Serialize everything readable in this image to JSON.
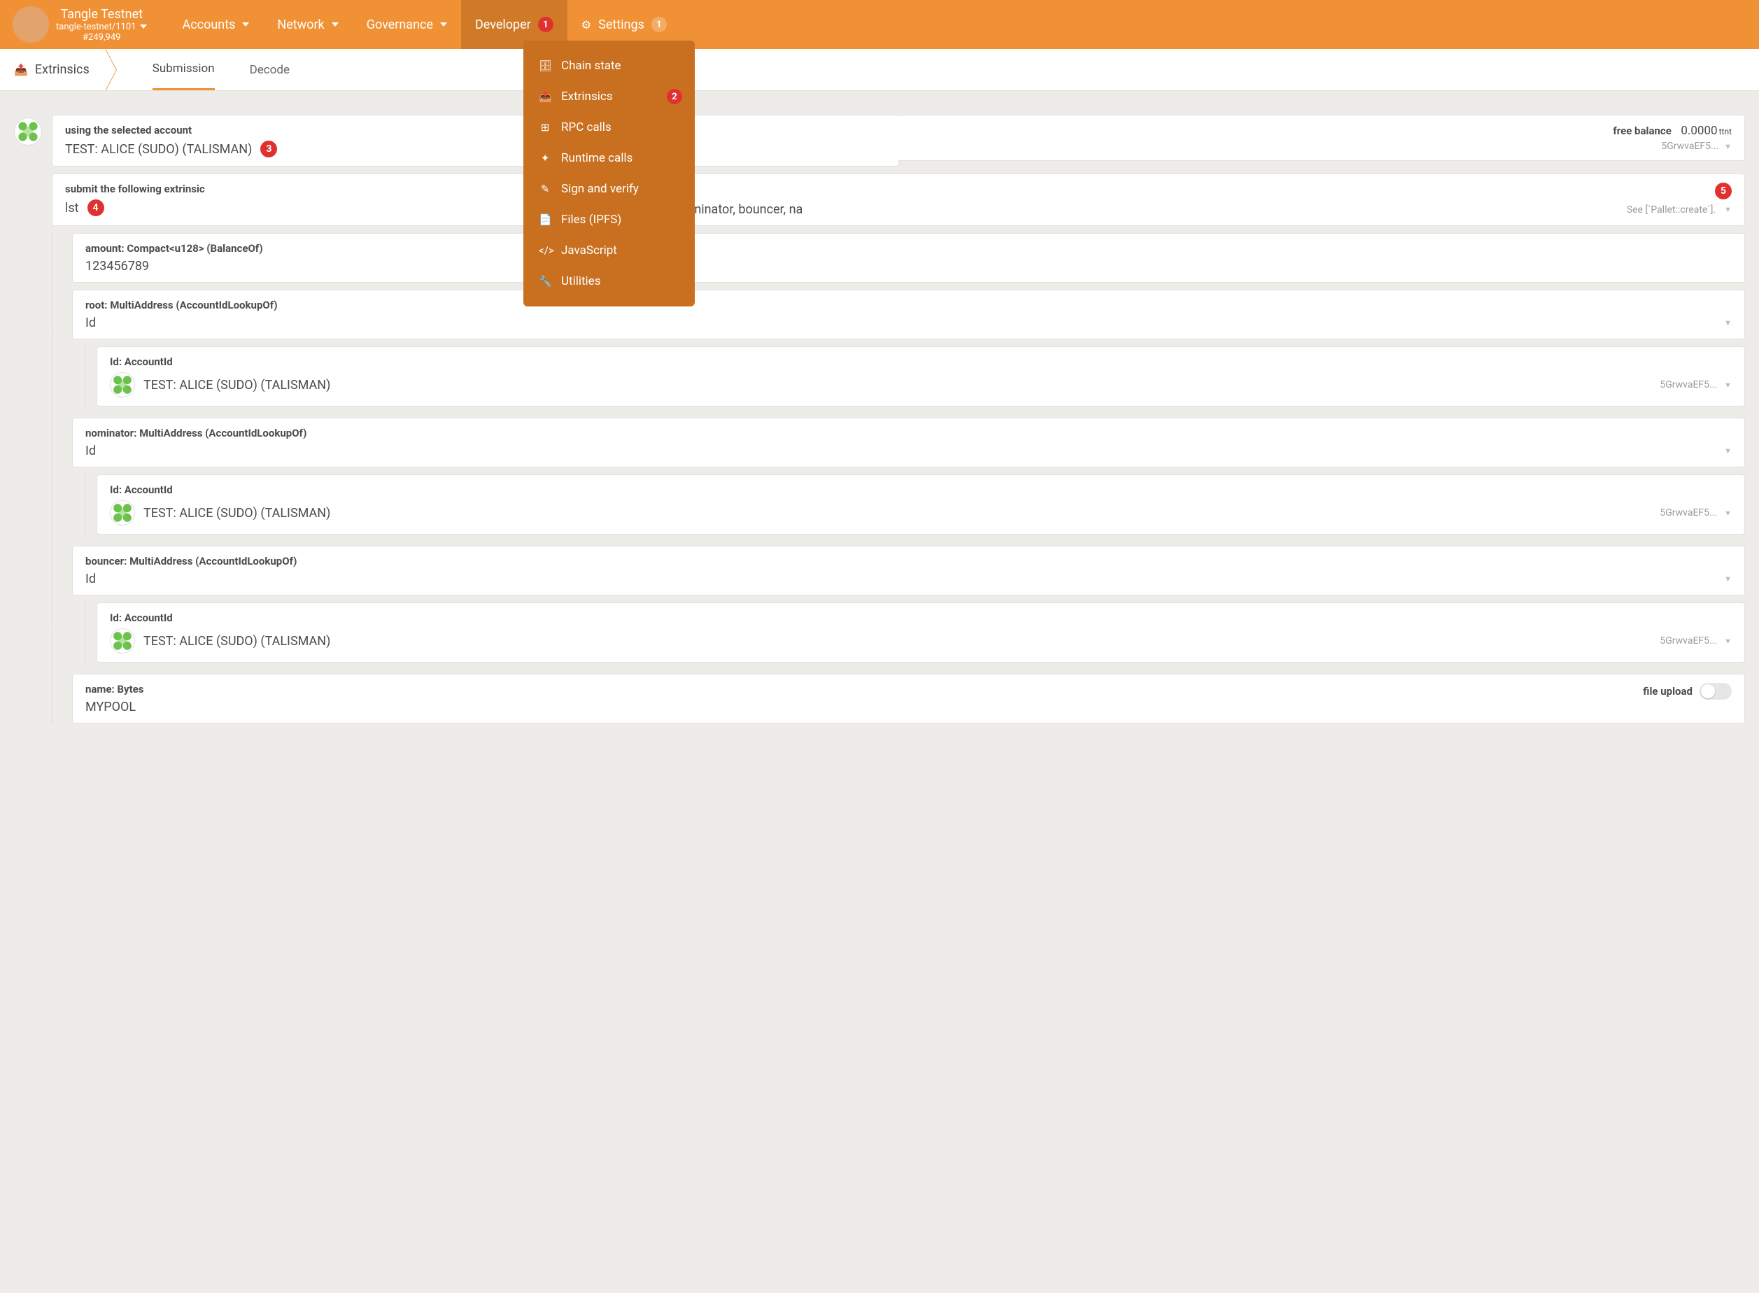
{
  "chain": {
    "name": "Tangle Testnet",
    "spec": "tangle-testnet/1101",
    "block": "#249,949"
  },
  "nav": {
    "accounts": "Accounts",
    "network": "Network",
    "governance": "Governance",
    "developer": "Developer",
    "settings": "Settings",
    "dev_badge": "1",
    "settings_badge": "1"
  },
  "dropdown": {
    "chain_state": "Chain state",
    "extrinsics": "Extrinsics",
    "extrinsics_badge": "2",
    "rpc": "RPC calls",
    "runtime": "Runtime calls",
    "sign": "Sign and verify",
    "files": "Files (IPFS)",
    "js": "JavaScript",
    "utilities": "Utilities"
  },
  "subbar": {
    "crumb": "Extrinsics",
    "submission": "Submission",
    "decode": "Decode"
  },
  "account": {
    "label": "using the selected account",
    "value": "TEST: ALICE (SUDO) (TALISMAN)",
    "badge": "3",
    "balance_label": "free balance",
    "balance_value": "0.0000",
    "balance_unit": "ttnt",
    "short_addr": "5GrwvaEF5..."
  },
  "extrinsic": {
    "label": "submit the following extrinsic",
    "pallet": "lst",
    "pallet_badge": "4",
    "call": "create(amount, root, nominator, bouncer, na",
    "call_badge": "5",
    "hint": "See [`Pallet::create`]."
  },
  "params": {
    "amount": {
      "label": "amount: Compact<u128> (BalanceOf)",
      "value": "123456789"
    },
    "root": {
      "label": "root: MultiAddress (AccountIdLookupOf)",
      "value": "Id",
      "id_label": "Id: AccountId",
      "id_value": "TEST: ALICE (SUDO) (TALISMAN)",
      "addr": "5GrwvaEF5..."
    },
    "nominator": {
      "label": "nominator: MultiAddress (AccountIdLookupOf)",
      "value": "Id",
      "id_label": "Id: AccountId",
      "id_value": "TEST: ALICE (SUDO) (TALISMAN)",
      "addr": "5GrwvaEF5..."
    },
    "bouncer": {
      "label": "bouncer: MultiAddress (AccountIdLookupOf)",
      "value": "Id",
      "id_label": "Id: AccountId",
      "id_value": "TEST: ALICE (SUDO) (TALISMAN)",
      "addr": "5GrwvaEF5..."
    },
    "name": {
      "label": "name: Bytes",
      "value": "MYPOOL",
      "upload_label": "file upload"
    }
  }
}
